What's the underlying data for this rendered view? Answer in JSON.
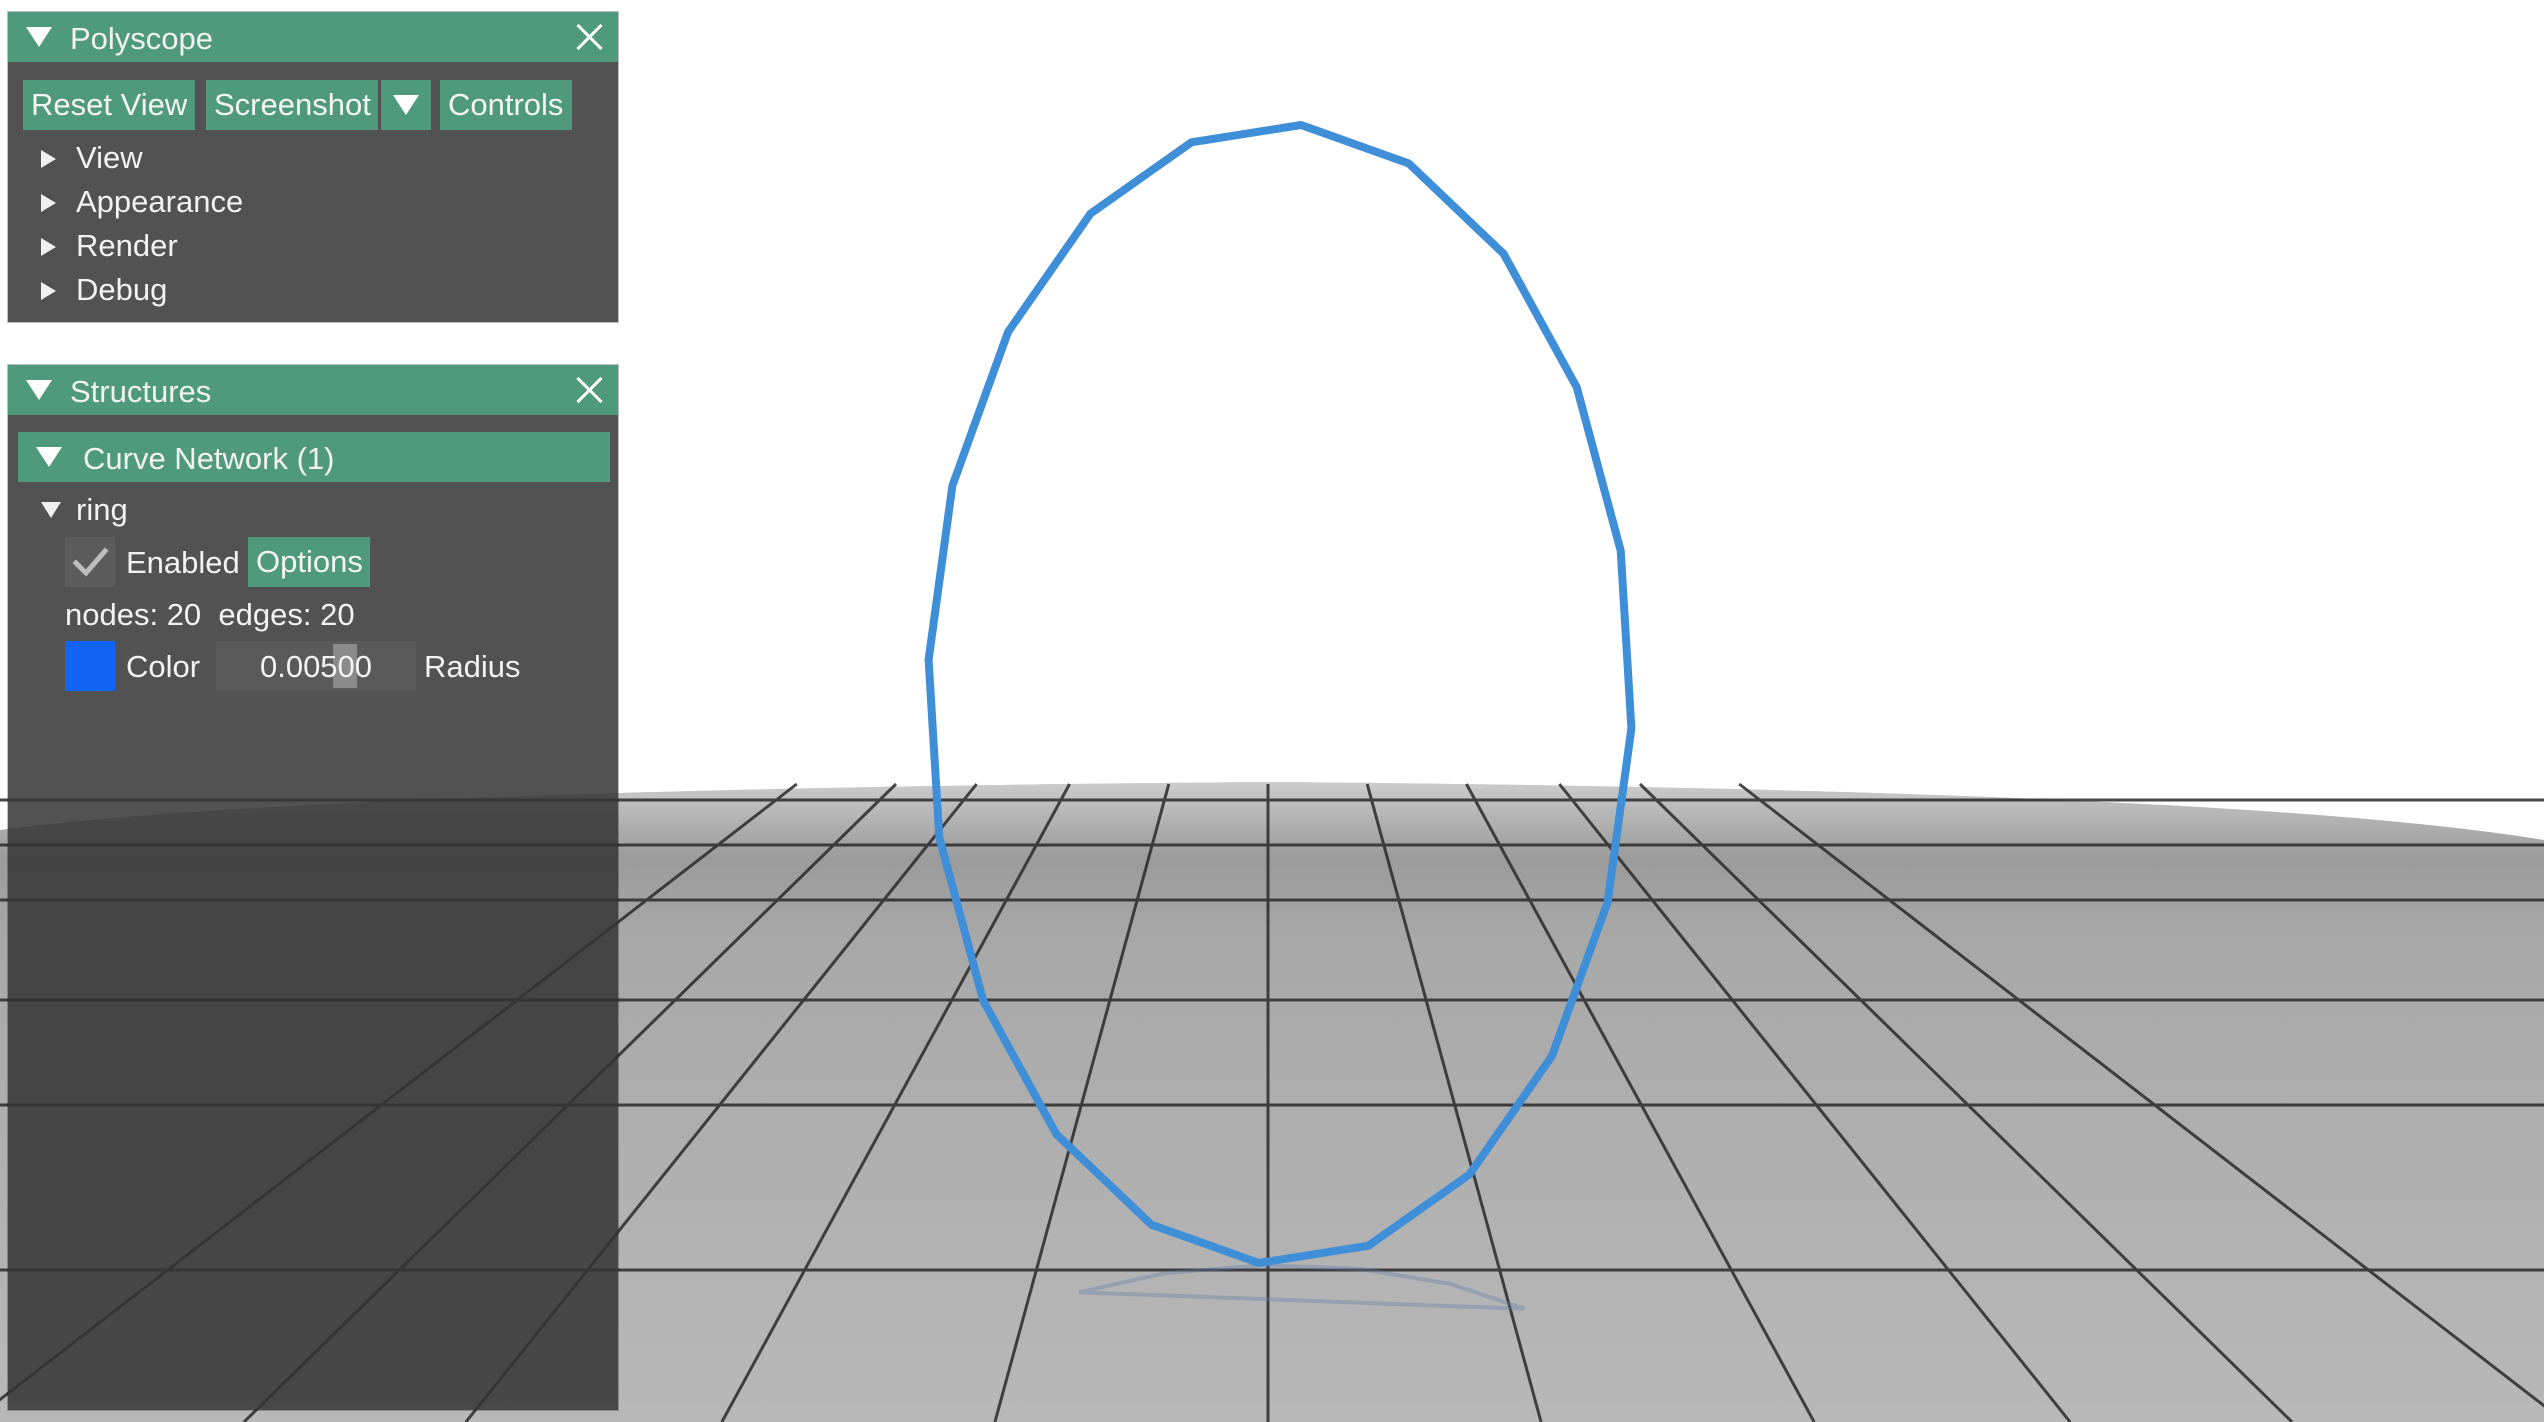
{
  "colors": {
    "accent": "#4f9a7d",
    "panel_bg": "#343434",
    "curve": "#3f8fd8",
    "swatch": "#1264f5",
    "floor": "#a9a9a9"
  },
  "scene": {
    "curve_network": "ring",
    "node_count": 20
  },
  "polyscope_panel": {
    "title": "Polyscope",
    "buttons": {
      "reset_view": "Reset View",
      "screenshot": "Screenshot",
      "controls": "Controls"
    },
    "sections": [
      "View",
      "Appearance",
      "Render",
      "Debug"
    ]
  },
  "structures_panel": {
    "title": "Structures",
    "group_header": "Curve Network (1)",
    "item": {
      "name": "ring",
      "enabled_label": "Enabled",
      "enabled": true,
      "options_button": "Options",
      "stats": "nodes: 20  edges: 20",
      "color_label": "Color",
      "radius_value": "0.00500",
      "radius_label": "Radius"
    }
  }
}
